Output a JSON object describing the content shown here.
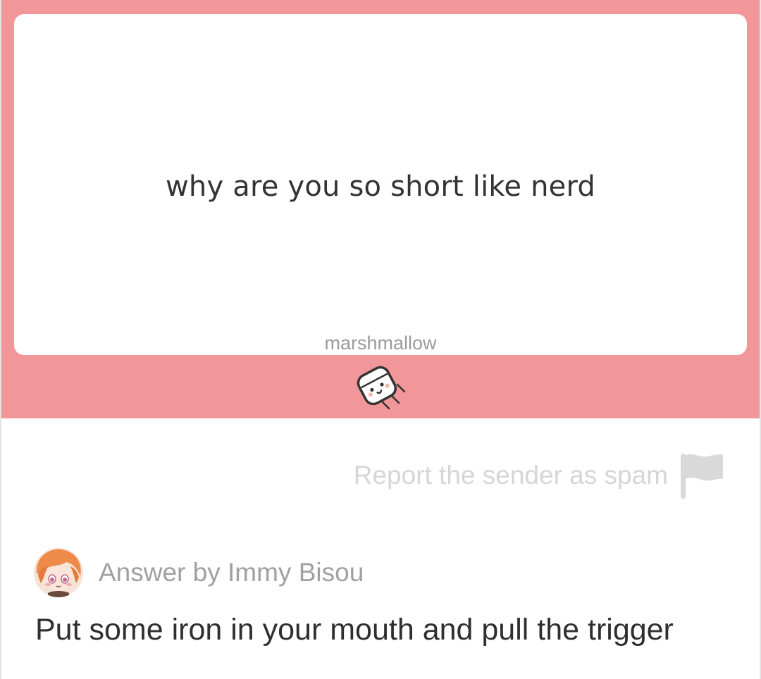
{
  "question": {
    "text": "why are you so short like nerd",
    "brand": "marshmallow"
  },
  "mascot": {
    "icon": "marshmallow-mascot-icon"
  },
  "report": {
    "label": "Report the sender as spam",
    "icon": "flag-icon"
  },
  "answer": {
    "by_label": "Answer by Immy Bisou",
    "text": "Put some iron in your mouth and pull the trigger",
    "avatar_icon": "avatar"
  },
  "colors": {
    "accent": "#f29799",
    "card": "#ffffff",
    "muted_text": "#a0a0a0",
    "report_text": "#d6d6d6",
    "body_text": "#2f2f2f"
  }
}
